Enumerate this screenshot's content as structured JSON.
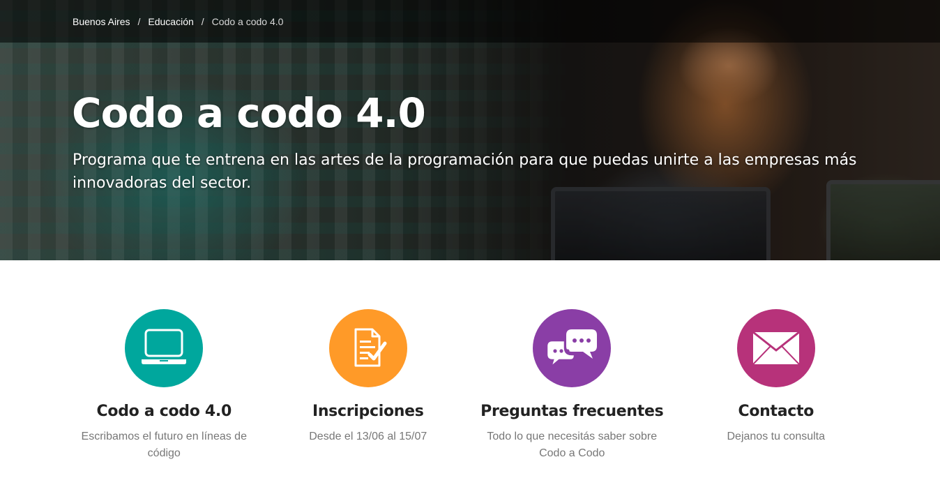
{
  "breadcrumb": {
    "items": [
      "Buenos Aires",
      "Educación"
    ],
    "separator": "/",
    "current": "Codo a codo 4.0"
  },
  "hero": {
    "title": "Codo a codo 4.0",
    "subtitle": "Programa que te entrena en las artes de la programación para que puedas unirte a las empresas más innovadoras del sector."
  },
  "features": [
    {
      "title": "Codo a codo 4.0",
      "description": "Escribamos el futuro en líneas de código",
      "icon": "laptop-icon",
      "color": "#00a79d"
    },
    {
      "title": "Inscripciones",
      "description": "Desde el 13/06 al 15/07",
      "icon": "form-check-icon",
      "color": "#ff9a28"
    },
    {
      "title": "Preguntas frecuentes",
      "description": "Todo lo que necesitás saber sobre Codo a Codo",
      "icon": "chat-bubbles-icon",
      "color": "#8a3ea6"
    },
    {
      "title": "Contacto",
      "description": "Dejanos tu consulta",
      "icon": "envelope-icon",
      "color": "#b7327a"
    }
  ]
}
